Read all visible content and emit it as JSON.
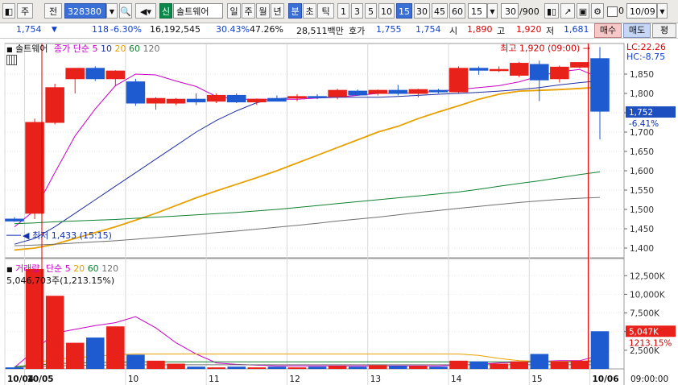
{
  "toolbar": {
    "tab_1": "주",
    "tab_2": "전",
    "code_input": "328380",
    "stock_badge": "신",
    "stock_name": "솔트웨어",
    "periods": [
      "일",
      "주",
      "월",
      "년",
      "분",
      "초",
      "틱"
    ],
    "minute_options": [
      "1",
      "3",
      "5",
      "10",
      "15",
      "30",
      "45",
      "60"
    ],
    "interval_value": "15",
    "count_value": "30",
    "count_max": "/900",
    "checkbox_label": "0",
    "date_value": "10/09"
  },
  "quote": {
    "price": "1,754",
    "arrow": "▼",
    "change": "118",
    "change_pct": "-6.30%",
    "volume": "16,192,545",
    "turnover_pct": "30.43%",
    "ratio_pct": "47.26%",
    "amount": "28,511백만",
    "label_hoga": "호가",
    "ask": "1,755",
    "bid": "1,754",
    "label_open": "시",
    "open": "1,890",
    "label_high": "고",
    "high": "1,920",
    "label_low": "저",
    "low": "1,681",
    "buy_label": "매수",
    "sell_label": "매도",
    "eval_label": "평"
  },
  "price_pane": {
    "title": "솔트웨어",
    "legend_name": "종가 단순",
    "ma_labels": [
      "5",
      "10",
      "20",
      "60",
      "120"
    ],
    "ma_colors": [
      "#c800c8",
      "#2030a0",
      "#e8a000",
      "#108030",
      "#707070"
    ],
    "lc": "LC:22.26",
    "hc": "HC:-8.75",
    "high_annot": "최고 1,920 (09:00)",
    "low_annot": "최저 1,433 (15:15)",
    "price_tag": "1,752",
    "pct_tag": "-6.41%",
    "ticks": [
      "1,850",
      "1,800",
      "1,750",
      "1,700",
      "1,650",
      "1,600",
      "1,550",
      "1,500",
      "1,450",
      "1,400"
    ]
  },
  "volume_pane": {
    "title": "거래량",
    "legend_name": "단순",
    "ma_labels": [
      "5",
      "20",
      "60",
      "120"
    ],
    "info": "5,046,703주(1,213.15%)",
    "vol_tag": "5,047K",
    "vol_pct": "1213.15%",
    "ticks": [
      "12,500K",
      "10,000K",
      "7,500K",
      "5,000K",
      "2,500K"
    ]
  },
  "xaxis": {
    "labels": [
      "10/04",
      "10/05",
      "10",
      "11",
      "12",
      "13",
      "14",
      "15",
      "10/06"
    ],
    "time_label": "09:00:00"
  },
  "chart_data": {
    "type": "candlestick",
    "unit": "KRW",
    "price_ylim": [
      1375,
      1900
    ],
    "volume_ylim": [
      0,
      13500000
    ],
    "candles": [
      {
        "o": 1475,
        "h": 1480,
        "l": 1468,
        "c": 1470,
        "v": 200000
      },
      {
        "o": 1490,
        "h": 1735,
        "l": 1475,
        "c": 1725,
        "v": 13400000
      },
      {
        "o": 1725,
        "h": 1825,
        "l": 1720,
        "c": 1815,
        "v": 9800000
      },
      {
        "o": 1838,
        "h": 1862,
        "l": 1800,
        "c": 1865,
        "v": 3500000
      },
      {
        "o": 1865,
        "h": 1870,
        "l": 1832,
        "c": 1838,
        "v": 4200000
      },
      {
        "o": 1838,
        "h": 1860,
        "l": 1818,
        "c": 1858,
        "v": 5700000
      },
      {
        "o": 1830,
        "h": 1838,
        "l": 1768,
        "c": 1775,
        "v": 1900000
      },
      {
        "o": 1775,
        "h": 1790,
        "l": 1758,
        "c": 1787,
        "v": 1100000
      },
      {
        "o": 1775,
        "h": 1788,
        "l": 1770,
        "c": 1785,
        "v": 700000
      },
      {
        "o": 1785,
        "h": 1800,
        "l": 1770,
        "c": 1778,
        "v": 300000
      },
      {
        "o": 1780,
        "h": 1800,
        "l": 1775,
        "c": 1795,
        "v": 200000
      },
      {
        "o": 1795,
        "h": 1800,
        "l": 1775,
        "c": 1778,
        "v": 300000
      },
      {
        "o": 1778,
        "h": 1787,
        "l": 1770,
        "c": 1785,
        "v": 200000
      },
      {
        "o": 1787,
        "h": 1795,
        "l": 1780,
        "c": 1780,
        "v": 300000
      },
      {
        "o": 1788,
        "h": 1798,
        "l": 1780,
        "c": 1792,
        "v": 200000
      },
      {
        "o": 1792,
        "h": 1798,
        "l": 1785,
        "c": 1790,
        "v": 300000
      },
      {
        "o": 1792,
        "h": 1812,
        "l": 1785,
        "c": 1808,
        "v": 400000
      },
      {
        "o": 1806,
        "h": 1810,
        "l": 1794,
        "c": 1796,
        "v": 300000
      },
      {
        "o": 1800,
        "h": 1810,
        "l": 1795,
        "c": 1808,
        "v": 500000
      },
      {
        "o": 1808,
        "h": 1822,
        "l": 1795,
        "c": 1800,
        "v": 400000
      },
      {
        "o": 1800,
        "h": 1812,
        "l": 1790,
        "c": 1810,
        "v": 400000
      },
      {
        "o": 1808,
        "h": 1812,
        "l": 1800,
        "c": 1804,
        "v": 300000
      },
      {
        "o": 1804,
        "h": 1870,
        "l": 1800,
        "c": 1865,
        "v": 1100000
      },
      {
        "o": 1865,
        "h": 1870,
        "l": 1848,
        "c": 1860,
        "v": 1000000
      },
      {
        "o": 1862,
        "h": 1870,
        "l": 1855,
        "c": 1862,
        "v": 700000
      },
      {
        "o": 1847,
        "h": 1882,
        "l": 1842,
        "c": 1878,
        "v": 1000000
      },
      {
        "o": 1875,
        "h": 1885,
        "l": 1780,
        "c": 1835,
        "v": 2000000
      },
      {
        "o": 1838,
        "h": 1872,
        "l": 1828,
        "c": 1868,
        "v": 1000000
      },
      {
        "o": 1868,
        "h": 1880,
        "l": 1865,
        "c": 1880,
        "v": 1100000
      },
      {
        "o": 1890,
        "h": 1920,
        "l": 1681,
        "c": 1754,
        "v": 5046703
      }
    ],
    "moving_averages": [
      {
        "period": 5,
        "values": [
          1455,
          1498,
          1595,
          1690,
          1760,
          1820,
          1850,
          1848,
          1832,
          1818,
          1792,
          1785,
          1785,
          1785,
          1785,
          1788,
          1790,
          1795,
          1800,
          1800,
          1802,
          1806,
          1810,
          1815,
          1820,
          1830,
          1845,
          1856,
          1862,
          1840
        ]
      },
      {
        "period": 10,
        "values": [
          1410,
          1425,
          1455,
          1490,
          1525,
          1560,
          1595,
          1630,
          1665,
          1700,
          1730,
          1755,
          1776,
          1786,
          1790,
          1790,
          1790,
          1790,
          1790,
          1792,
          1795,
          1798,
          1800,
          1803,
          1806,
          1810,
          1815,
          1822,
          1828,
          1833
        ]
      },
      {
        "period": 20,
        "values": [
          1395,
          1400,
          1410,
          1425,
          1440,
          1455,
          1472,
          1490,
          1510,
          1530,
          1548,
          1565,
          1582,
          1600,
          1620,
          1640,
          1660,
          1680,
          1700,
          1715,
          1735,
          1752,
          1768,
          1785,
          1798,
          1806,
          1808,
          1810,
          1813,
          1816
        ]
      },
      {
        "period": 60,
        "values": [
          1463,
          1465,
          1468,
          1470,
          1472,
          1474,
          1477,
          1480,
          1483,
          1486,
          1489,
          1492,
          1496,
          1500,
          1505,
          1510,
          1515,
          1520,
          1525,
          1530,
          1535,
          1540,
          1545,
          1552,
          1560,
          1567,
          1574,
          1582,
          1590,
          1597
        ]
      },
      {
        "period": 120,
        "values": [
          1406,
          1408,
          1410,
          1413,
          1416,
          1419,
          1423,
          1427,
          1431,
          1435,
          1440,
          1444,
          1449,
          1454,
          1459,
          1464,
          1470,
          1475,
          1480,
          1486,
          1492,
          1497,
          1503,
          1508,
          1513,
          1518,
          1522,
          1526,
          1529,
          1531
        ]
      }
    ],
    "volume_ma": [
      {
        "period": 5,
        "values": [
          180000,
          2500000,
          4800000,
          5300000,
          5800000,
          6200000,
          7000000,
          5500000,
          3500000,
          2000000,
          800000,
          600000,
          500000,
          400000,
          400000,
          400000,
          400000,
          400000,
          400000,
          400000,
          400000,
          400000,
          500000,
          600000,
          800000,
          900000,
          1000000,
          1100000,
          1100000,
          1800000
        ]
      },
      {
        "period": 20,
        "values": [
          100000,
          800000,
          1300000,
          1500000,
          1700000,
          1900000,
          2000000,
          2000000,
          2000000,
          2000000,
          2000000,
          2000000,
          2000000,
          2000000,
          2000000,
          2000000,
          2000000,
          2000000,
          2000000,
          2000000,
          2000000,
          2000000,
          2000000,
          1800000,
          1400000,
          1100000,
          1000000,
          1000000,
          1000000,
          1200000
        ]
      },
      {
        "period": 60,
        "values": [
          300000,
          500000,
          700000,
          800000,
          850000,
          900000,
          950000,
          950000,
          950000,
          950000,
          950000,
          950000,
          950000,
          950000,
          950000,
          950000,
          950000,
          950000,
          950000,
          950000,
          950000,
          950000,
          950000,
          950000,
          950000,
          950000,
          950000,
          950000,
          950000,
          980000
        ]
      },
      {
        "period": 120,
        "values": [
          200000,
          300000,
          400000,
          450000,
          500000,
          520000,
          540000,
          550000,
          550000,
          550000,
          550000,
          550000,
          550000,
          550000,
          550000,
          550000,
          550000,
          550000,
          550000,
          550000,
          550000,
          550000,
          550000,
          550000,
          550000,
          550000,
          550000,
          550000,
          550000,
          560000
        ]
      }
    ]
  }
}
